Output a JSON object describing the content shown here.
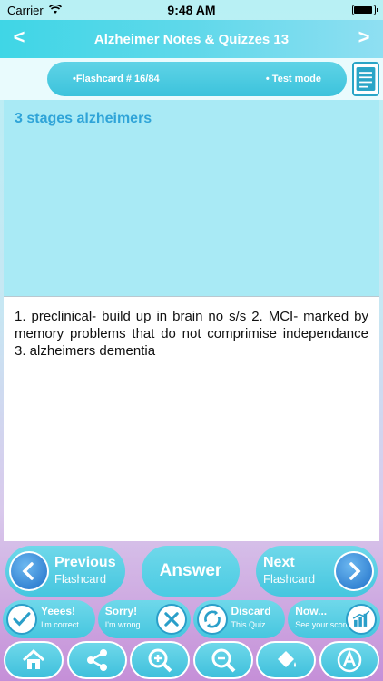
{
  "status_bar": {
    "carrier": "Carrier",
    "time": "9:48 AM"
  },
  "nav": {
    "title": "Alzheimer Notes & Quizzes 13",
    "back": "<",
    "forward": ">"
  },
  "info": {
    "flashcard_label": "•Flashcard #  16/84",
    "mode_label": "• Test mode"
  },
  "card": {
    "question": "3 stages alzheimers",
    "answer": "1. preclinical- build up in brain no s/s 2. MCI- marked by memory problems that do not comprimise independance 3. alzheimers dementia"
  },
  "flash_nav": {
    "previous_main": "Previous",
    "previous_sub": "Flashcard",
    "answer": "Answer",
    "next_main": "Next",
    "next_sub": "Flashcard"
  },
  "quiz": [
    {
      "main": "Yeees!",
      "sub": "I'm correct",
      "icon": "checkmark-icon"
    },
    {
      "main": "Sorry!",
      "sub": "I'm wrong",
      "icon": "x-icon"
    },
    {
      "main": "Discard",
      "sub": "This Quiz",
      "icon": "recycle-icon"
    },
    {
      "main": "Now...",
      "sub": "See your score",
      "icon": "chart-icon"
    }
  ],
  "toolbar": [
    "home-icon",
    "share-icon",
    "zoom-in-icon",
    "zoom-out-icon",
    "paint-bucket-icon",
    "font-icon"
  ],
  "colors": {
    "accent": "#46c6df",
    "question": "#2fa4d8",
    "question_bg": "#a9eaf5"
  }
}
